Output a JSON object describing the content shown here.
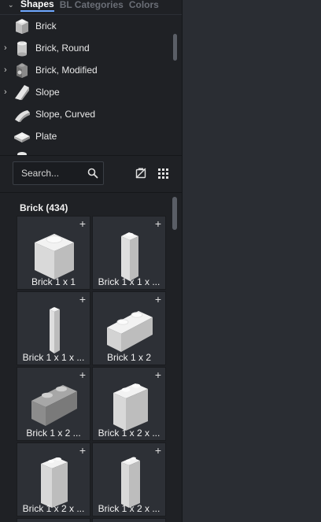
{
  "tabs": [
    {
      "label": "Shapes",
      "active": true
    },
    {
      "label": "BL Categories",
      "active": false
    },
    {
      "label": "Colors",
      "active": false
    }
  ],
  "tree": {
    "items": [
      {
        "label": "Brick",
        "expandable": false,
        "icon": "brick-icon"
      },
      {
        "label": "Brick, Round",
        "expandable": true,
        "icon": "round-brick-icon"
      },
      {
        "label": "Brick, Modified",
        "expandable": true,
        "icon": "modified-brick-icon"
      },
      {
        "label": "Slope",
        "expandable": true,
        "icon": "slope-icon"
      },
      {
        "label": "Slope, Curved",
        "expandable": false,
        "icon": "curved-slope-icon"
      },
      {
        "label": "Plate",
        "expandable": false,
        "icon": "plate-icon"
      }
    ]
  },
  "search": {
    "placeholder": "Search..."
  },
  "grid": {
    "header": "Brick (434)",
    "items": [
      {
        "label": "Brick 1 x 1",
        "shape": "1x1"
      },
      {
        "label": "Brick 1 x 1 x ...",
        "shape": "1x1tall"
      },
      {
        "label": "Brick 1 x 1 x ...",
        "shape": "1x1vtall"
      },
      {
        "label": "Brick 1 x 2",
        "shape": "1x2"
      },
      {
        "label": "Brick 1 x 2 ...",
        "shape": "1x2grey"
      },
      {
        "label": "Brick 1 x 2 x ...",
        "shape": "1x2x2"
      },
      {
        "label": "Brick 1 x 2 x ...",
        "shape": "1x2x3"
      },
      {
        "label": "Brick 1 x 2 x ...",
        "shape": "1x2x3b"
      }
    ]
  },
  "colors": {
    "panel": "#1f2125",
    "background": "#2a2d33",
    "accent": "#6fa8ff"
  }
}
